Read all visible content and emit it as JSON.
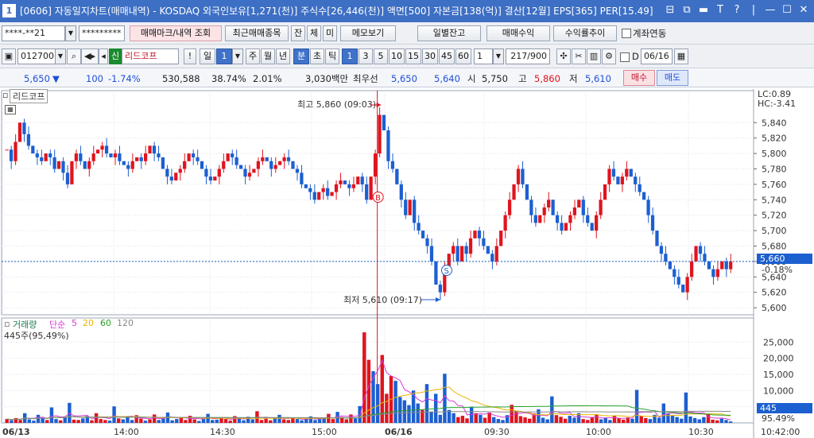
{
  "window": {
    "badge": "1",
    "title": "[0606] 자동일지차트(매매내역) - KOSDAQ 외국인보유[1,271(천)] 주식수[26,446(천)] 액면[500] 자본금[138(억)] 결산[12월] EPS[365] PER[15.49]",
    "buttons": [
      "⊟",
      "⧉",
      "▬",
      "T",
      "?",
      "|",
      "—",
      "☐",
      "✕"
    ]
  },
  "toolbar1": {
    "account": "****-**21",
    "password": "*********",
    "trade_mark_btn": "매매마크/내역 조회",
    "recent_btn": "최근매매종목",
    "jan_btn": "잔",
    "che_btn": "체",
    "mi_btn": "미",
    "memo_btn": "메모보기",
    "daily_btn": "일별잔고",
    "profit_btn": "매매수익",
    "rate_btn": "수익률추이",
    "link_label": "계좌연동"
  },
  "toolbar2": {
    "code": "012700",
    "sin_badge": "신",
    "stock_name": "리드코프",
    "excl": "!",
    "il": "일",
    "il_num": "1",
    "periods": [
      "주",
      "월",
      "년",
      "분",
      "초",
      "틱"
    ],
    "active_period": "분",
    "intervals": [
      "1",
      "3",
      "5",
      "10",
      "15",
      "30",
      "45",
      "60"
    ],
    "active_interval": "1",
    "count_input": "1",
    "range_text": "217/900",
    "d_label": "D",
    "date": "06/16"
  },
  "price_strip": {
    "price": "5,650",
    "down_arrow": "▼",
    "change": "100",
    "change_pct": "-1.74%",
    "volume": "530,588",
    "ratio1": "38.74%",
    "ratio2": "2.01%",
    "amount": "3,030백만",
    "best_label": "최우선",
    "best_ask": "5,650",
    "best_bid": "5,640",
    "open_label": "시",
    "open": "5,750",
    "high_label": "고",
    "high": "5,860",
    "low_label": "저",
    "low": "5,610",
    "buy_btn": "매수",
    "sell_btn": "매도"
  },
  "chart": {
    "name_label": "리드코프",
    "lc_label": "LC:0.89",
    "hc_label": "HC:-3.41",
    "high_annot": "최고 5,860 (09:03)",
    "low_annot": "최저 5,610 (09:17)",
    "buy_marker": "B",
    "sell_marker": "S",
    "current_price_tag": "5,660",
    "current_pct_tag": "-0.18%",
    "vol_legend": {
      "name": "거래량",
      "ma": "단순",
      "periods": [
        "5",
        "20",
        "60",
        "120"
      ],
      "colors": [
        "#d63bd6",
        "#e8b400",
        "#2aa02a",
        "#888888"
      ]
    },
    "vol_info": "445주(95,49%)",
    "vol_tag": "445",
    "vol_pct_tag": "95.49%",
    "time_labels": [
      "06/13",
      "14:00",
      "14:30",
      "15:00",
      "06/16",
      "09:30",
      "10:00",
      "10:30"
    ],
    "time_readout": "10:42:00"
  },
  "chart_data": {
    "type": "candlestick",
    "price_axis": {
      "ticks": [
        5600,
        5620,
        5640,
        5660,
        5680,
        5700,
        5720,
        5740,
        5760,
        5780,
        5800,
        5820,
        5840
      ],
      "ylim": [
        5595,
        5865
      ]
    },
    "volume_axis": {
      "ticks": [
        5000,
        10000,
        15000,
        20000,
        25000
      ],
      "ylim": [
        0,
        29000
      ]
    },
    "sessions": [
      {
        "date": "06/13",
        "start": "13:20",
        "end": "15:30"
      },
      {
        "date": "06/16",
        "start": "09:00",
        "end": "10:42"
      }
    ],
    "highs_lows": {
      "high": 5860,
      "high_time": "09:03",
      "low": 5610,
      "low_time": "09:17"
    },
    "last_price": 5660,
    "last_volume": 445,
    "up_color": "#e0141e",
    "down_color": "#1c5fd0",
    "price_path": [
      5805,
      5790,
      5815,
      5840,
      5825,
      5810,
      5800,
      5795,
      5790,
      5800,
      5795,
      5780,
      5790,
      5775,
      5760,
      5790,
      5800,
      5790,
      5780,
      5790,
      5800,
      5805,
      5810,
      5800,
      5795,
      5800,
      5790,
      5785,
      5780,
      5790,
      5795,
      5790,
      5800,
      5810,
      5800,
      5795,
      5780,
      5770,
      5765,
      5775,
      5780,
      5790,
      5800,
      5795,
      5790,
      5780,
      5770,
      5765,
      5770,
      5780,
      5790,
      5800,
      5795,
      5785,
      5780,
      5770,
      5775,
      5780,
      5790,
      5795,
      5790,
      5780,
      5785,
      5790,
      5795,
      5790,
      5780,
      5775,
      5760,
      5755,
      5750,
      5740,
      5750,
      5755,
      5745,
      5750,
      5760,
      5765,
      5760,
      5755,
      5760,
      5770,
      5760,
      5740,
      5770,
      5800,
      5850,
      5830,
      5790,
      5780,
      5760,
      5740,
      5720,
      5740,
      5710,
      5700,
      5690,
      5680,
      5660,
      5630,
      5620,
      5650,
      5670,
      5680,
      5660,
      5680,
      5670,
      5690,
      5700,
      5690,
      5680,
      5670,
      5660,
      5680,
      5700,
      5720,
      5740,
      5760,
      5780,
      5760,
      5740,
      5720,
      5710,
      5720,
      5730,
      5740,
      5720,
      5710,
      5700,
      5710,
      5720,
      5730,
      5740,
      5720,
      5710,
      5700,
      5720,
      5740,
      5760,
      5780,
      5770,
      5760,
      5770,
      5780,
      5770,
      5760,
      5750,
      5740,
      5720,
      5700,
      5680,
      5670,
      5660,
      5650,
      5640,
      5630,
      5620,
      5640,
      5660,
      5680,
      5670,
      5660,
      5650,
      5640,
      5650,
      5660,
      5650,
      5660
    ],
    "volume_path": [
      1200,
      800,
      1500,
      900,
      3000,
      1100,
      700,
      2500,
      1600,
      900,
      4800,
      1200,
      800,
      1900,
      6200,
      1000,
      900,
      1400,
      2100,
      800,
      3000,
      1200,
      900,
      700,
      5100,
      1400,
      1100,
      1800,
      900,
      2400,
      1300,
      700,
      1100,
      2600,
      900,
      1500,
      3200,
      800,
      1200,
      1700,
      900,
      2200,
      1100,
      600,
      1300,
      2800,
      900,
      1000,
      1600,
      1200,
      700,
      2100,
      1400,
      800,
      1900,
      1100,
      3600,
      900,
      1300,
      800,
      1400,
      2500,
      1100,
      900,
      1700,
      1200,
      800,
      1300,
      2000,
      900,
      1100,
      1500,
      2800,
      1200,
      3400,
      1800,
      1100,
      2600,
      1400,
      5200,
      28000,
      19500,
      16000,
      12000,
      21000,
      9000,
      14500,
      13000,
      8000,
      7000,
      5500,
      10000,
      6000,
      4000,
      12000,
      3500,
      9000,
      2500,
      15200,
      4000,
      3000,
      1800,
      2200,
      1400,
      5000,
      3000,
      2500,
      1600,
      3200,
      1800,
      1200,
      900,
      2400,
      5600,
      3800,
      2100,
      1700,
      1300,
      2900,
      4200,
      1600,
      1100,
      8200,
      2400,
      1900,
      1300,
      2200,
      1600,
      3000,
      1200,
      900,
      1800,
      2600,
      1100,
      1500,
      900,
      2300,
      1400,
      1000,
      1700,
      1300,
      10200,
      2100,
      1500,
      1200,
      2500,
      1600,
      6000,
      3000,
      2200,
      1800,
      1300,
      9400,
      2000,
      1500,
      1100,
      1800,
      2600,
      1000,
      800,
      1300,
      900,
      445
    ]
  }
}
